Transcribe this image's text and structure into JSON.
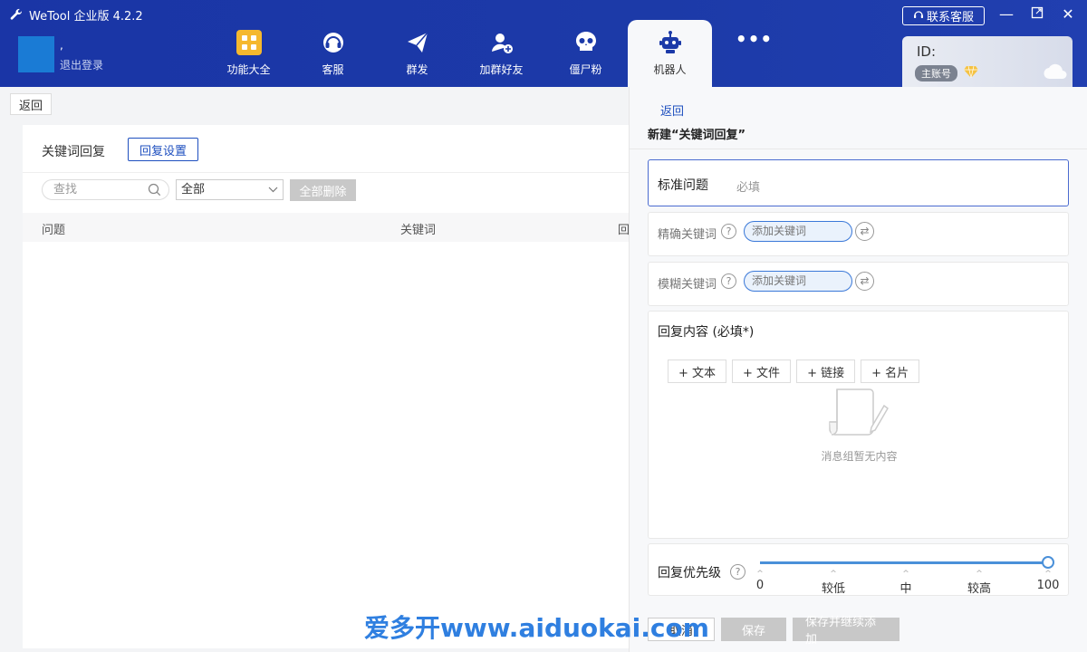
{
  "app": {
    "title": "WeTool 企业版 4.2.2"
  },
  "profile": {
    "name": ",",
    "logout": "退出登录"
  },
  "nav": [
    {
      "label": "功能大全",
      "icon": "grid-icon"
    },
    {
      "label": "客服",
      "icon": "headset-icon"
    },
    {
      "label": "群发",
      "icon": "paper-plane-icon"
    },
    {
      "label": "加群好友",
      "icon": "add-user-icon"
    },
    {
      "label": "僵尸粉",
      "icon": "skull-icon"
    },
    {
      "label": "机器人",
      "icon": "robot-icon",
      "active": true
    },
    {
      "label": "",
      "icon": "more-icon"
    }
  ],
  "header": {
    "contact": "联系客服",
    "id_label": "ID:",
    "account_badge": "主账号"
  },
  "left": {
    "back": "返回",
    "title": "关键词回复",
    "reply_settings": "回复设置",
    "search_placeholder": "查找",
    "filter_value": "全部",
    "delete_all": "全部删除",
    "columns": [
      "问题",
      "关键词",
      "回"
    ]
  },
  "drawer": {
    "back": "返回",
    "title": "新建“关键词回复”",
    "standard_question": {
      "label": "标准问题",
      "placeholder": "必填"
    },
    "exact_keyword": {
      "label": "精确关键词",
      "placeholder": "添加关键词"
    },
    "fuzzy_keyword": {
      "label": "模糊关键词",
      "placeholder": "添加关键词"
    },
    "reply_content": {
      "label": "回复内容 (必填*)",
      "buttons": [
        "+ 文本",
        "+ 文件",
        "+ 链接",
        "+ 名片"
      ],
      "empty": "消息组暂无内容"
    },
    "priority": {
      "label": "回复优先级",
      "ticks": [
        "0",
        "较低",
        "中",
        "较高",
        "100"
      ],
      "value": 100
    },
    "footer": {
      "cancel": "取消",
      "save": "保存",
      "save_continue": "保存并继续添加"
    }
  },
  "watermark": "爱多开www.aiduokai.com",
  "colors": {
    "nav_bg": "#1c3aa8",
    "accent": "#1e4fbf",
    "slider": "#4a90d9"
  }
}
